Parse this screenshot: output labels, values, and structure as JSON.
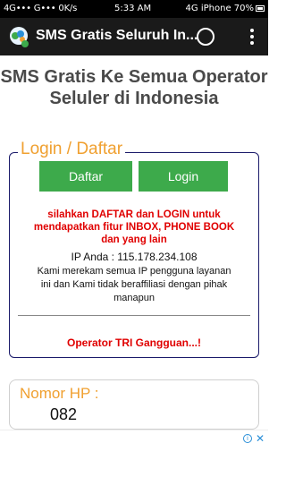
{
  "status_bar": {
    "left": "4G••• G••• 0K/s",
    "time": "5:33 AM",
    "right": "4G iPhone 70%"
  },
  "app_bar": {
    "title": "SMS Gratis Seluruh In..."
  },
  "heading": {
    "line1": "SMS Gratis Ke Semua Operator",
    "line2": "Seluler di Indonesia"
  },
  "login": {
    "legend": "Login / Daftar",
    "daftar_label": "Daftar",
    "login_label": "Login",
    "info_line1": "silahkan DAFTAR dan LOGIN untuk",
    "info_line2": "mendapatkan fitur INBOX, PHONE BOOK",
    "info_line3": "dan yang lain",
    "ip_text": "IP Anda : 115.178.234.108",
    "note_line1": "Kami merekam semua IP pengguna layanan",
    "note_line2": "ini dan Kami tidak beraffiliasi dengan pihak",
    "note_line3": "manapun",
    "operator_msg": "Operator TRI Gangguan...!"
  },
  "phone_field": {
    "label": "Nomor HP :",
    "value": "082"
  },
  "ad": {
    "info_icon": "i",
    "close_icon": "✕"
  },
  "colors": {
    "accent_green": "#3daa4b",
    "legend_orange": "#f0a030",
    "alert_red": "#e00000",
    "app_bar": "#1a1a1a"
  }
}
